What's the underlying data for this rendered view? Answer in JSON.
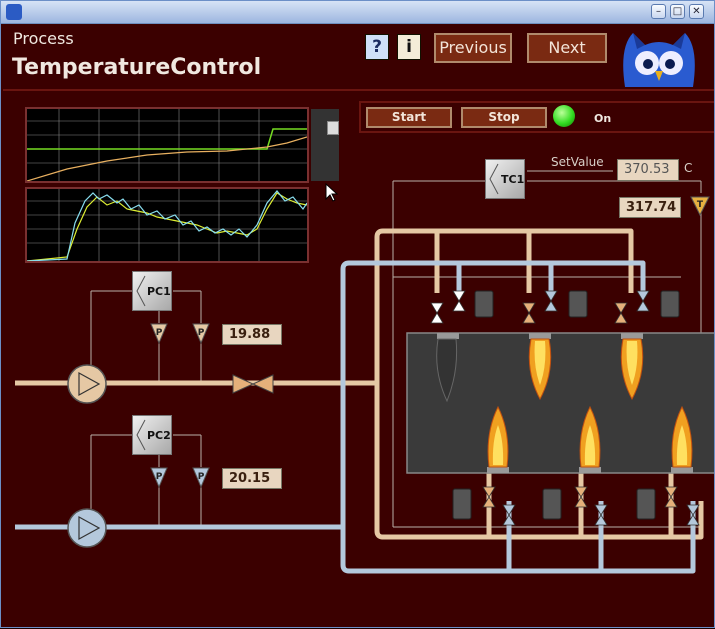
{
  "window": {
    "title_icon": "app-icon",
    "controls": [
      "minimize",
      "maximize",
      "close"
    ]
  },
  "header": {
    "process_label": "Process",
    "title": "TemperatureControl",
    "help_label": "?",
    "info_label": "i",
    "previous_label": "Previous",
    "next_label": "Next",
    "logo": "owl-logo"
  },
  "controls": {
    "start_label": "Start",
    "stop_label": "Stop",
    "status_label": "On",
    "status_color": "#33dd22"
  },
  "tc1": {
    "label": "TC1",
    "setvalue_label": "SetValue",
    "setvalue": "370.53",
    "unit": "C",
    "measured": "317.74",
    "sensor_letter": "T"
  },
  "pc1": {
    "label": "PC1",
    "sensor_letter": "P",
    "value": "19.88"
  },
  "pc2": {
    "label": "PC2",
    "sensor_letter": "P",
    "value": "20.15"
  },
  "colors": {
    "background": "#3b0000",
    "gas_pipe": "#e5c8a4",
    "air_pipe": "#b4c8dc",
    "button": "#7a2a12"
  }
}
